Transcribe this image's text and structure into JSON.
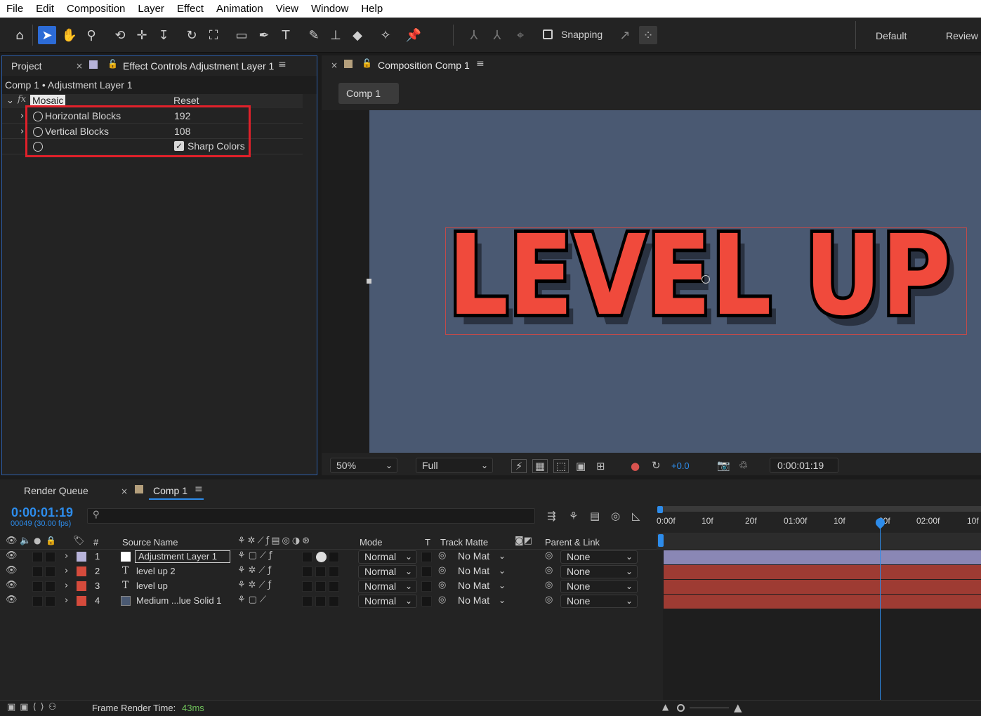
{
  "menu": [
    "File",
    "Edit",
    "Composition",
    "Layer",
    "Effect",
    "Animation",
    "View",
    "Window",
    "Help"
  ],
  "toolbar": {
    "snapping_label": "Snapping",
    "workspaces": [
      "Default",
      "Review"
    ]
  },
  "effect_panel": {
    "tab_project": "Project",
    "tab_effect": "Effect Controls Adjustment Layer 1",
    "breadcrumb": "Comp 1 • Adjustment Layer 1",
    "effect_name": "Mosaic",
    "reset_label": "Reset",
    "params": [
      {
        "name": "Horizontal Blocks",
        "value": "192"
      },
      {
        "name": "Vertical Blocks",
        "value": "108"
      }
    ],
    "sharp_colors_label": "Sharp Colors",
    "sharp_colors_checked": true,
    "highlight_color": "#e0202a"
  },
  "comp_panel": {
    "tab_label": "Composition Comp 1",
    "comp_button": "Comp 1",
    "artwork_text": "LEVEL UP",
    "bg_color": "#4a5972",
    "text_color": "#f04a3c",
    "zoom": "50%",
    "resolution": "Full",
    "exposure": "+0.0",
    "timecode": "0:00:01:19"
  },
  "timeline": {
    "tab_render": "Render Queue",
    "tab_comp": "Comp 1",
    "timecode": "0:00:01:19",
    "frame_info": "00049 (30.00 fps)",
    "search_placeholder": "",
    "columns": {
      "num": "#",
      "source": "Source Name",
      "mode": "Mode",
      "t": "T",
      "track_matte": "Track Matte",
      "parent": "Parent & Link"
    },
    "ruler": [
      "0:00f",
      "10f",
      "20f",
      "01:00f",
      "10f",
      "20f",
      "02:00f",
      "10f"
    ],
    "layers": [
      {
        "num": "1",
        "name": "Adjustment Layer 1",
        "type": "adjustment",
        "label_color": "#b7b3d9",
        "mode": "Normal",
        "matte": "No Mat",
        "parent": "None"
      },
      {
        "num": "2",
        "name": "level up 2",
        "type": "text",
        "label_color": "#d64b3c",
        "mode": "Normal",
        "matte": "No Mat",
        "parent": "None"
      },
      {
        "num": "3",
        "name": "level up",
        "type": "text",
        "label_color": "#d64b3c",
        "mode": "Normal",
        "matte": "No Mat",
        "parent": "None"
      },
      {
        "num": "4",
        "name": "Medium ...lue Solid 1",
        "type": "solid",
        "label_color": "#d64b3c",
        "mode": "Normal",
        "matte": "No Mat",
        "parent": "None"
      }
    ],
    "footer_label": "Frame Render Time:",
    "footer_value": "43ms"
  }
}
